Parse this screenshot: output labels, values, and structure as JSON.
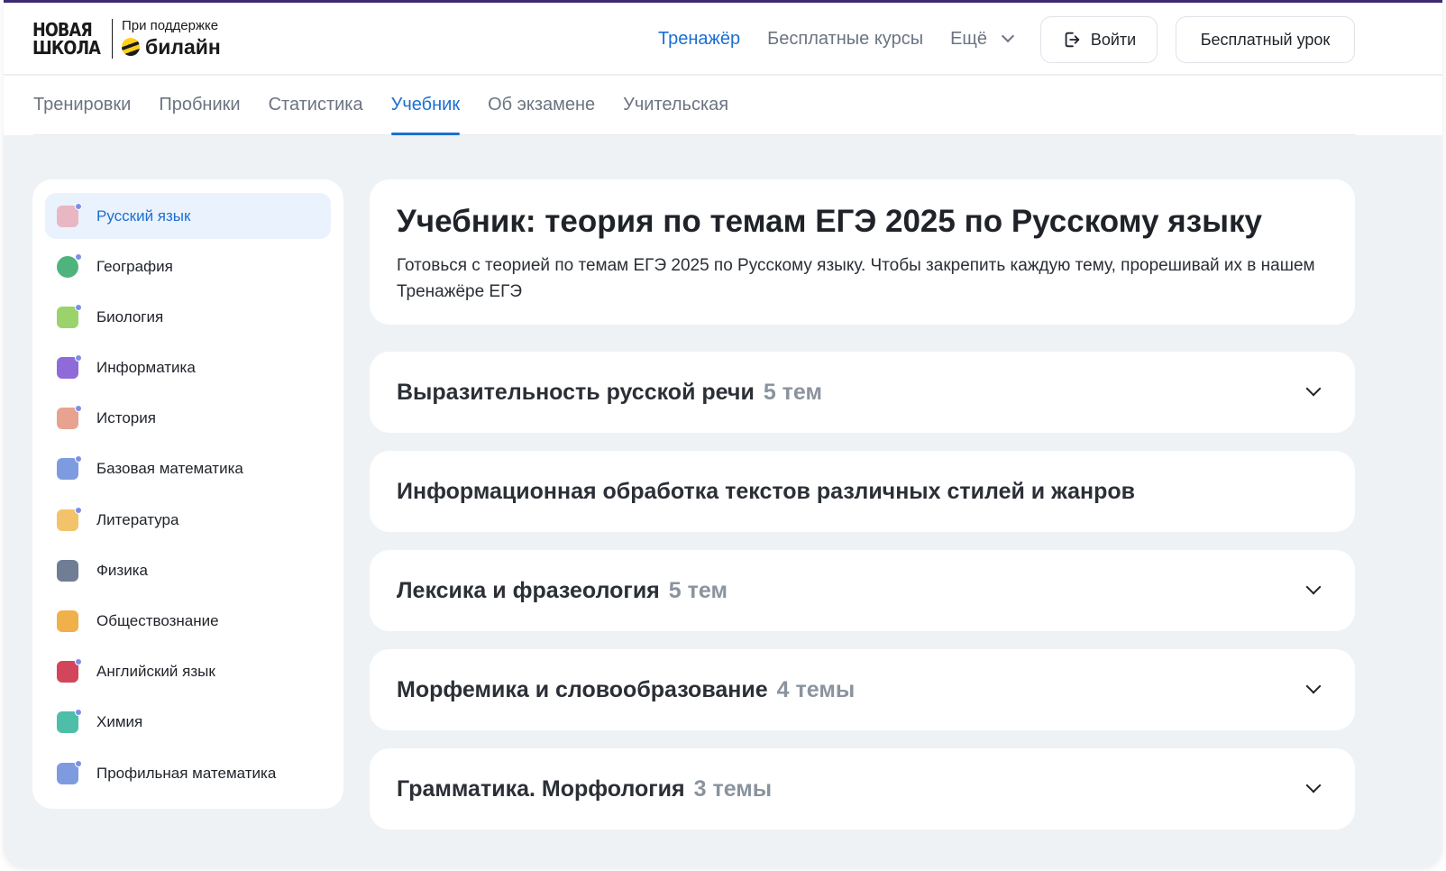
{
  "header": {
    "logo_line1": "НОВАЯ",
    "logo_line2": "ШКОЛА",
    "support_text": "При поддержке",
    "brand_name": "билайн",
    "nav": [
      {
        "label": "Тренажёр",
        "active": true
      },
      {
        "label": "Бесплатные курсы",
        "active": false
      }
    ],
    "more_label": "Ещё",
    "login_label": "Войти",
    "free_lesson_label": "Бесплатный урок"
  },
  "subnav": {
    "tabs": [
      "Тренировки",
      "Пробники",
      "Статистика",
      "Учебник",
      "Об экзамене",
      "Учительская"
    ],
    "active_tab": "Учебник"
  },
  "sidebar": {
    "items": [
      {
        "label": "Русский язык",
        "icon": "russian-language-icon",
        "color": "#e8b7c2",
        "active": true
      },
      {
        "label": "География",
        "icon": "globe-icon",
        "color": "#4fb37d",
        "active": false
      },
      {
        "label": "Биология",
        "icon": "dna-icon",
        "color": "#9ad36b",
        "active": false
      },
      {
        "label": "Информатика",
        "icon": "computer-icon",
        "color": "#8e6bd8",
        "active": false
      },
      {
        "label": "История",
        "icon": "column-icon",
        "color": "#e7a38f",
        "active": false
      },
      {
        "label": "Базовая математика",
        "icon": "calculator-icon",
        "color": "#7f9be0",
        "active": false
      },
      {
        "label": "Литература",
        "icon": "book-icon",
        "color": "#f2c36b",
        "active": false
      },
      {
        "label": "Физика",
        "icon": "board-icon",
        "color": "#6f7d95",
        "active": false
      },
      {
        "label": "Обществознание",
        "icon": "scales-icon",
        "color": "#f0b04a",
        "active": false
      },
      {
        "label": "Английский язык",
        "icon": "uk-flag-icon",
        "color": "#d3455b",
        "active": false
      },
      {
        "label": "Химия",
        "icon": "flask-icon",
        "color": "#4dbfa8",
        "active": false
      },
      {
        "label": "Профильная математика",
        "icon": "calculator-icon",
        "color": "#7f9be0",
        "active": false
      }
    ]
  },
  "hero": {
    "title": "Учебник: теория по темам ЕГЭ 2025 по Русскому языку",
    "description": "Готовься с теорией по темам ЕГЭ 2025 по Русскому языку. Чтобы закрепить каждую тему, прорешивай их в нашем Тренажёре ЕГЭ"
  },
  "sections": [
    {
      "title": "Выразительность русской речи",
      "count": "5 тем",
      "expandable": true
    },
    {
      "title": "Информационная обработка текстов различных стилей и жанров",
      "count": "",
      "expandable": false
    },
    {
      "title": "Лексика и фразеология",
      "count": "5 тем",
      "expandable": true
    },
    {
      "title": "Морфемика и словообразование",
      "count": "4 темы",
      "expandable": true
    },
    {
      "title": "Грамматика. Морфология",
      "count": "3 темы",
      "expandable": true
    }
  ],
  "colors": {
    "accent": "#1b6fd1",
    "page_bg": "#eef2f5",
    "muted_text": "#6b7480"
  }
}
